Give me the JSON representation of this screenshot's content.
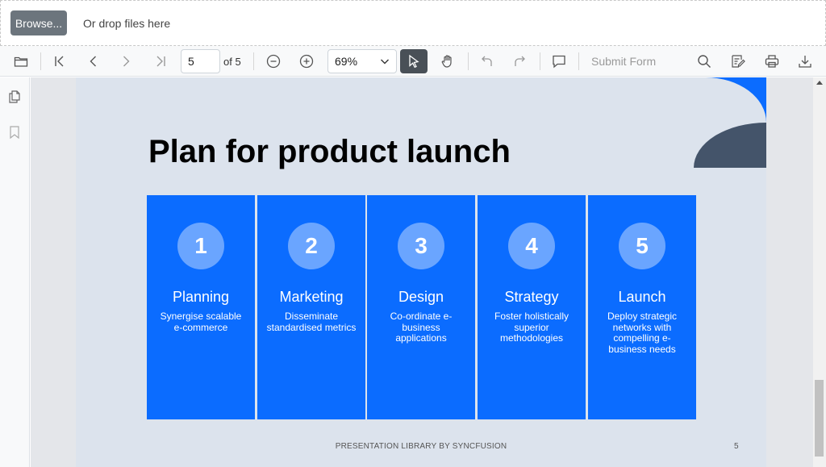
{
  "uploader": {
    "browse_label": "Browse...",
    "drop_text": "Or drop files here"
  },
  "toolbar": {
    "current_page": "5",
    "page_total": "of 5",
    "zoom": "69%",
    "submit_form_label": "Submit Form",
    "icons": [
      "open-folder-icon",
      "first-page-icon",
      "previous-page-icon",
      "next-page-icon",
      "last-page-icon",
      "zoom-out-icon",
      "zoom-in-icon",
      "chevron-down-icon",
      "text-selection-icon",
      "pan-hand-icon",
      "undo-icon",
      "redo-icon",
      "comment-icon",
      "search-icon",
      "annotation-edit-icon",
      "print-icon",
      "download-icon"
    ]
  },
  "sidebar": {
    "icons": [
      "page-thumbnails-icon",
      "bookmark-icon"
    ]
  },
  "slide": {
    "title": "Plan for product launch",
    "steps": [
      {
        "number": "1",
        "title": "Planning",
        "desc": "Synergise scalable e-commerce"
      },
      {
        "number": "2",
        "title": "Marketing",
        "desc": "Disseminate standardised metrics"
      },
      {
        "number": "3",
        "title": "Design",
        "desc": "Co-ordinate e-business applications"
      },
      {
        "number": "4",
        "title": "Strategy",
        "desc": "Foster holistically superior methodologies"
      },
      {
        "number": "5",
        "title": "Launch",
        "desc": "Deploy strategic networks with compelling e-business needs"
      }
    ],
    "footer": "PRESENTATION LIBRARY BY SYNCFUSION",
    "page_number": "5"
  },
  "colors": {
    "card_blue": "#0b6cff",
    "circle_blue": "#6aa5ff",
    "slide_bg": "#dce3ed",
    "deco_dark": "#44546a",
    "select_tool_bg": "#495057",
    "browse_bg": "#6c757d"
  }
}
